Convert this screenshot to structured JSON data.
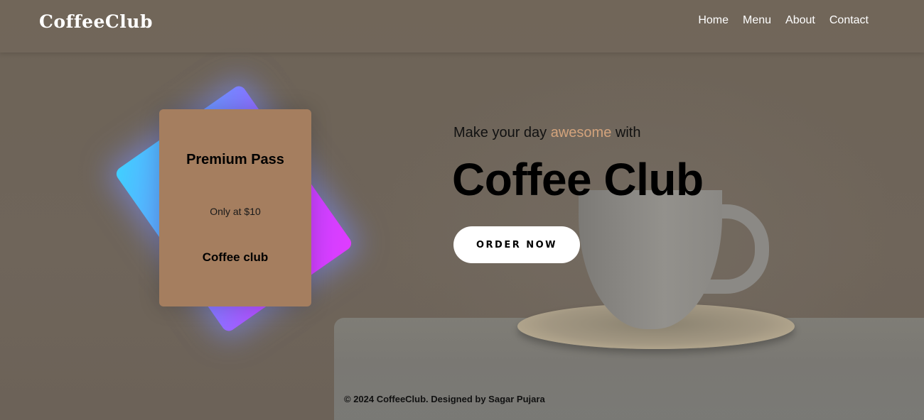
{
  "header": {
    "logo": "CoffeeClub",
    "nav": [
      "Home",
      "Menu",
      "About",
      "Contact"
    ]
  },
  "card": {
    "title": "Premium Pass",
    "price": "Only at $10",
    "subtitle": "Coffee club"
  },
  "hero": {
    "tagline_prefix": "Make your day ",
    "tagline_accent": "awesome",
    "tagline_suffix": " with",
    "title": "Coffee Club",
    "button": "ORDER NOW"
  },
  "footer": {
    "text": "© 2024 CoffeeClub. Designed by Sagar Pujara"
  },
  "colors": {
    "accent": "#d3a37c",
    "card": "#a57e5f",
    "button_bg": "#ffffff"
  }
}
